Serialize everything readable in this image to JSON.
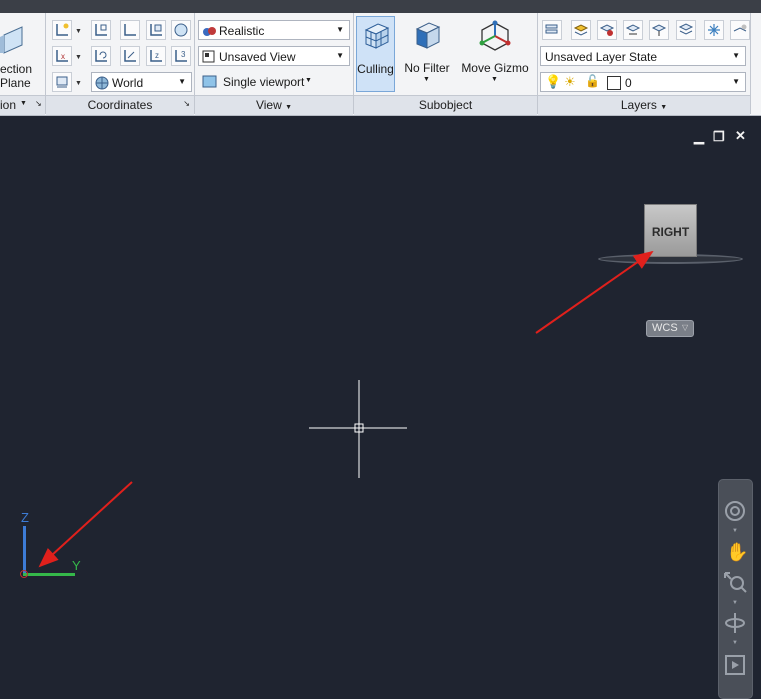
{
  "ribbon": {
    "section_panel": {
      "label_line1": "ection",
      "label_line2": "Plane",
      "footer": "ion"
    },
    "coordinates_panel": {
      "footer": "Coordinates",
      "world_combo": "World"
    },
    "view_panel": {
      "visual_style": "Realistic",
      "named_view": "Unsaved View",
      "viewport": "Single viewport",
      "footer": "View"
    },
    "subobject_panel": {
      "culling": "Culling",
      "no_filter": "No Filter",
      "move_gizmo": "Move Gizmo",
      "footer": "Subobject"
    },
    "layers_panel": {
      "layer_state": "Unsaved Layer State",
      "current_layer": "0",
      "footer": "Layers"
    }
  },
  "viewport": {
    "viewcube_label": "RIGHT",
    "wcs_label": "WCS",
    "ucs_z": "Z",
    "ucs_y": "Y"
  },
  "colors": {
    "canvas": "#1f2430",
    "annotation_arrow": "#e0201c",
    "ucs_z": "#3d7cd6",
    "ucs_y": "#35b84a"
  }
}
